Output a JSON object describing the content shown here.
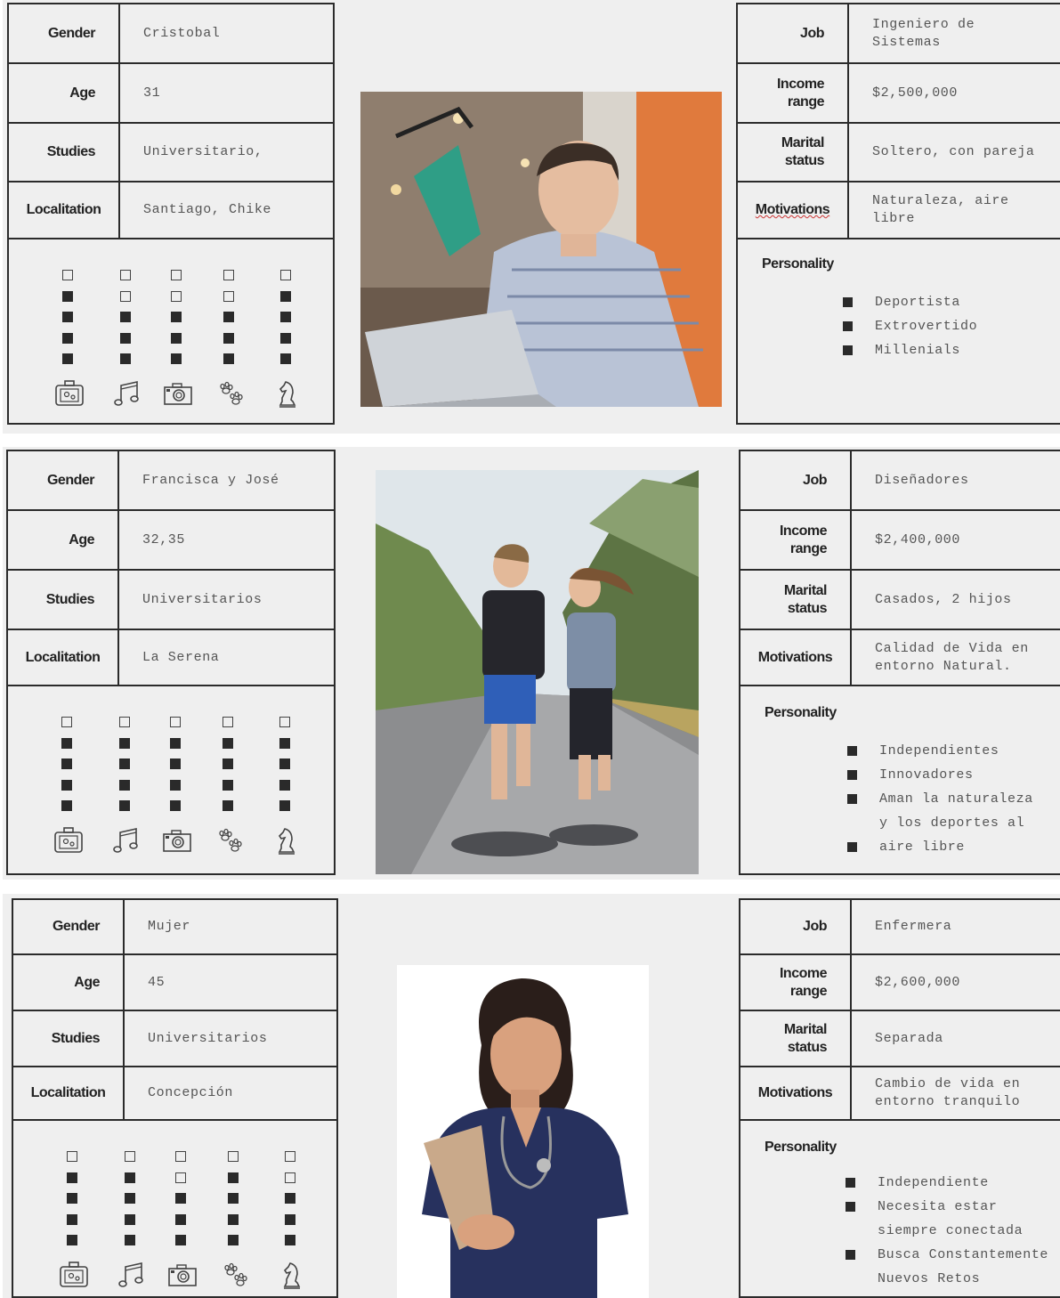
{
  "personas": [
    {
      "gender_label": "Gender",
      "gender": "Cristobal",
      "age_label": "Age",
      "age": "31",
      "studies_label": "Studies",
      "studies": "Universitario,",
      "location_label": "Localitation",
      "location": "Santiago, Chike",
      "job_label": "Job",
      "job": "Ingeniero de\nSistemas",
      "income_label": "Income\nrange",
      "income": "$2,500,000",
      "marital_label": "Marital\nstatus",
      "marital": "Soltero, con pareja",
      "motivations_label": "Motivations",
      "motivations": "Naturaleza, aire\nlibre",
      "personality_label": "Personality",
      "personality": [
        "Deportista",
        "Extrovertido",
        "Millenials"
      ],
      "interest_levels": [
        4,
        3,
        3,
        3,
        4
      ],
      "interest_icons": [
        "luggage-icon",
        "music-note-icon",
        "camera-icon",
        "paw-prints-icon",
        "chess-knight-icon"
      ]
    },
    {
      "gender_label": "Gender",
      "gender": "Francisca y José",
      "age_label": "Age",
      "age": "32,35",
      "studies_label": "Studies",
      "studies": "Universitarios",
      "location_label": "Localitation",
      "location": "La Serena",
      "job_label": "Job",
      "job": "Diseñadores",
      "income_label": "Income\nrange",
      "income": "$2,400,000",
      "marital_label": "Marital\nstatus",
      "marital": "Casados, 2 hijos",
      "motivations_label": "Motivations",
      "motivations": "Calidad de Vida en\nentorno Natural.",
      "personality_label": "Personality",
      "personality": [
        "Independientes",
        "Innovadores",
        "Aman la naturaleza",
        "y los deportes al",
        "aire libre"
      ],
      "interest_levels": [
        4,
        4,
        4,
        4,
        4
      ],
      "interest_icons": [
        "luggage-icon",
        "music-note-icon",
        "camera-icon",
        "paw-prints-icon",
        "chess-knight-icon"
      ]
    },
    {
      "gender_label": "Gender",
      "gender": "Mujer",
      "age_label": "Age",
      "age": "45",
      "studies_label": "Studies",
      "studies": "Universitarios",
      "location_label": "Localitation",
      "location": "Concepción",
      "job_label": "Job",
      "job": "Enfermera",
      "income_label": "Income\nrange",
      "income": "$2,600,000",
      "marital_label": "Marital\nstatus",
      "marital": "Separada",
      "motivations_label": "Motivations",
      "motivations": "Cambio de vida en\nentorno tranquilo",
      "personality_label": "Personality",
      "personality": [
        "Independiente",
        "Necesita estar",
        "siempre conectada",
        "Busca Constantemente",
        "Nuevos Retos"
      ],
      "interest_levels": [
        4,
        4,
        3,
        4,
        3
      ],
      "interest_icons": [
        "luggage-icon",
        "music-note-icon",
        "camera-icon",
        "paw-prints-icon",
        "chess-knight-icon"
      ]
    }
  ]
}
